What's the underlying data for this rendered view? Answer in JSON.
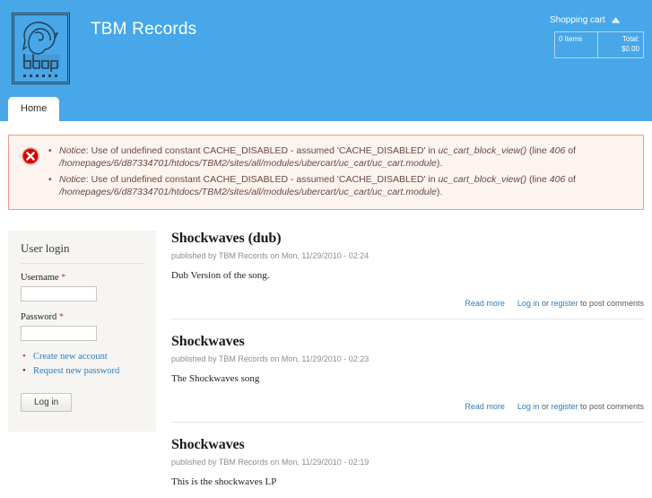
{
  "header": {
    "site_name": "TBM Records",
    "logo_alt": "tbmp records logo",
    "accent_color": "#47a7e8",
    "cart": {
      "title": "Shopping cart",
      "icon": "shopping-cart-icon",
      "items_label": "0 Items",
      "total_label": "Total:",
      "total_value": "$0.00"
    },
    "tabs": [
      {
        "label": "Home",
        "active": true
      }
    ]
  },
  "messages": {
    "icon": "error-icon",
    "border_color": "#ed9c86",
    "background_color": "#fdf3ef",
    "items": [
      {
        "prefix": "Notice",
        "text": ": Use of undefined constant CACHE_DISABLED - assumed 'CACHE_DISABLED' in ",
        "function": "uc_cart_block_view()",
        "line_label": " (line ",
        "line": "406",
        "of": " of ",
        "path": "/homepages/6/d87334701/htdocs/TBM2/sites/all/modules/ubercart/uc_cart/uc_cart.module",
        "suffix": ")."
      },
      {
        "prefix": "Notice",
        "text": ": Use of undefined constant CACHE_DISABLED - assumed 'CACHE_DISABLED' in ",
        "function": "uc_cart_block_view()",
        "line_label": " (line ",
        "line": "406",
        "of": " of ",
        "path": "/homepages/6/d87334701/htdocs/TBM2/sites/all/modules/ubercart/uc_cart/uc_cart.module",
        "suffix": ")."
      }
    ]
  },
  "sidebar": {
    "login_block": {
      "title": "User login",
      "username_label": "Username",
      "username_value": "",
      "password_label": "Password",
      "password_value": "",
      "required_marker": "*",
      "links": [
        {
          "label": "Create new account"
        },
        {
          "label": "Request new password"
        }
      ],
      "submit_label": "Log in"
    }
  },
  "content": {
    "nodes": [
      {
        "title": "Shockwaves (dub)",
        "submitted": "published by TBM Records on Mon, 11/29/2010 - 02:24",
        "body": "Dub Version of the song.",
        "read_more": "Read more",
        "login_link": "Log in",
        "or_text": " or ",
        "register_link": "register",
        "post_text": " to post comments"
      },
      {
        "title": "Shockwaves",
        "submitted": "published by TBM Records on Mon, 11/29/2010 - 02:23",
        "body": "The Shockwaves song",
        "read_more": "Read more",
        "login_link": "Log in",
        "or_text": " or ",
        "register_link": "register",
        "post_text": " to post comments"
      },
      {
        "title": "Shockwaves",
        "submitted": "published by TBM Records on Mon, 11/29/2010 - 02:19",
        "body": "This is the shockwaves LP",
        "read_more": "",
        "login_link": "",
        "or_text": "",
        "register_link": "",
        "post_text": ""
      }
    ]
  }
}
